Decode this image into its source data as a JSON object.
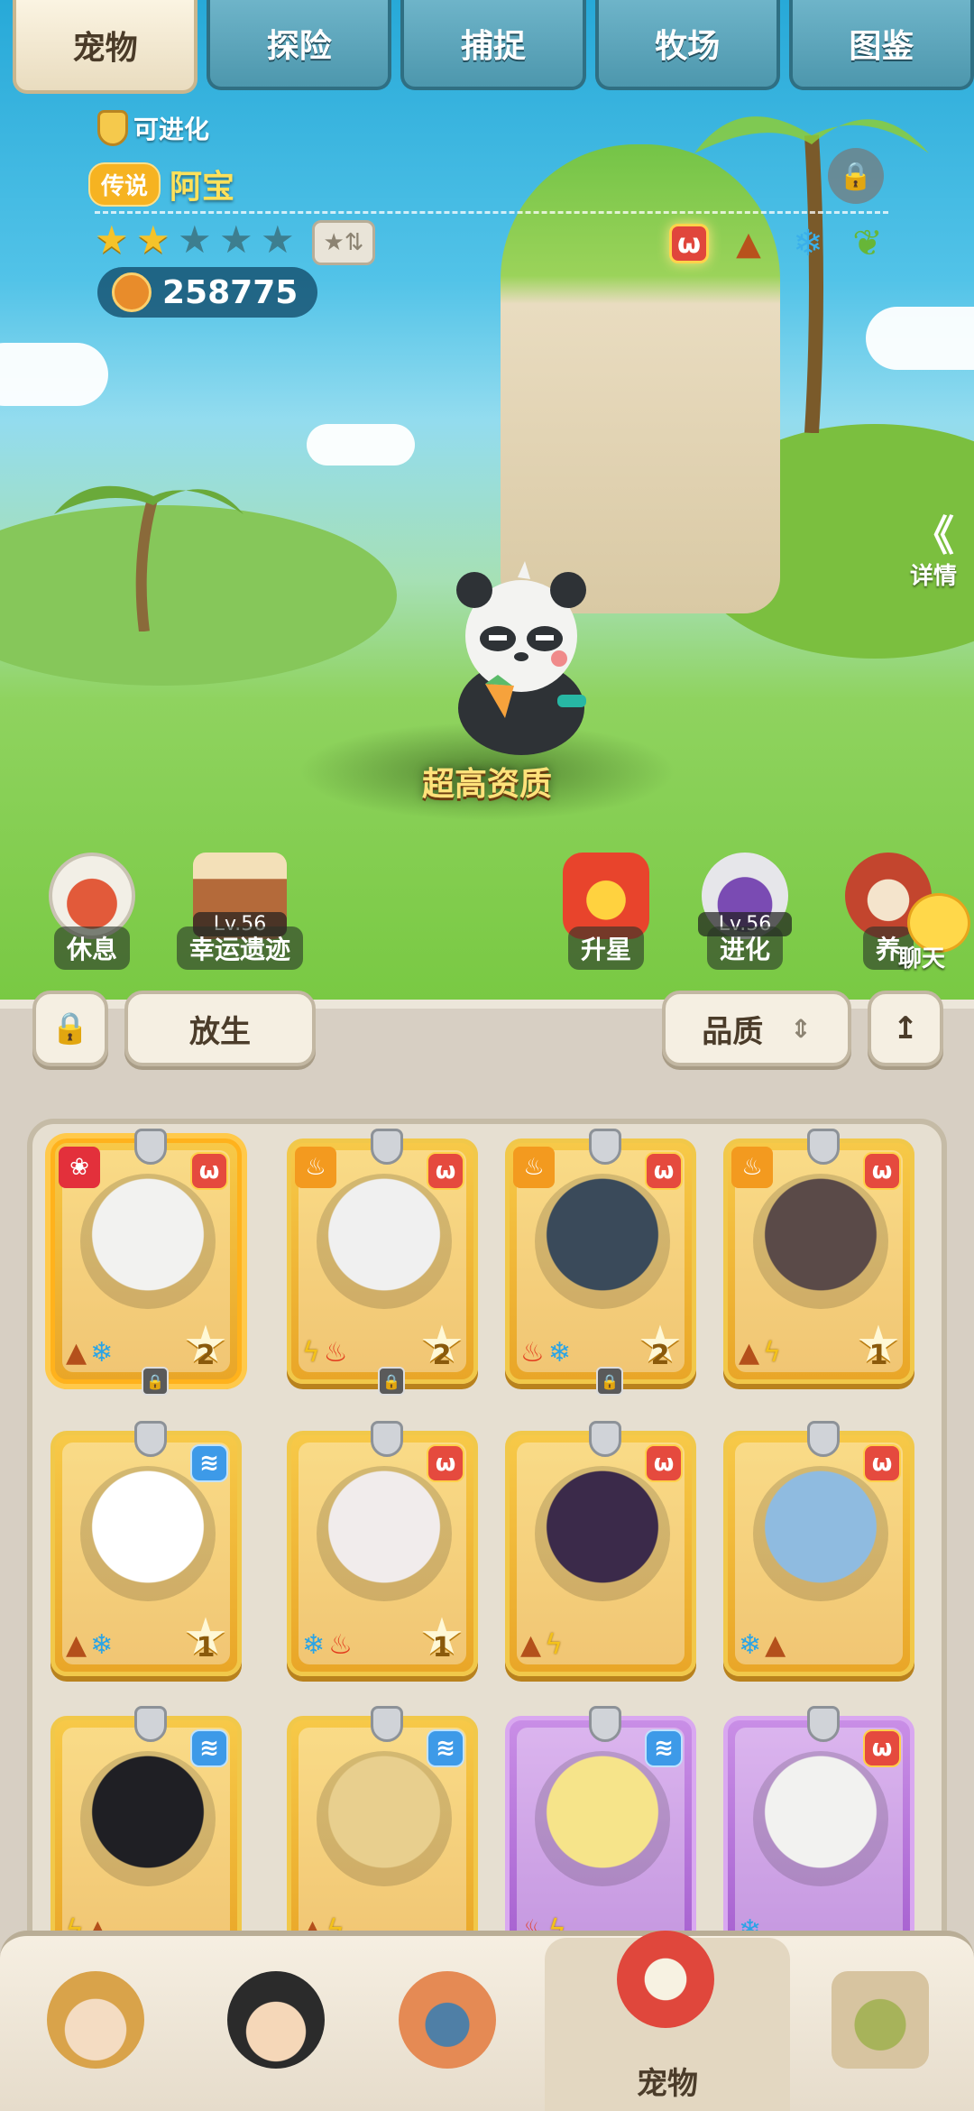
{
  "tabs": [
    "宠物",
    "探险",
    "捕捉",
    "牧场",
    "图鉴"
  ],
  "active_tab": "宠物",
  "pet": {
    "evolve_label": "可进化",
    "rarity": "传说",
    "name": "阿宝",
    "stars_filled": 2,
    "stars_total": 5,
    "power": "258775",
    "quality_text": "超高资质",
    "trait_icons": [
      "red-paw-trait-icon",
      "earth-trait-icon",
      "ice-trait-icon",
      "leaf-trait-icon"
    ]
  },
  "detail": {
    "chevron": "《",
    "label": "详情"
  },
  "actions": [
    {
      "label": "休息",
      "level": ""
    },
    {
      "label": "幸运遗迹",
      "level": "Lv.56"
    },
    {
      "label": "升星",
      "level": ""
    },
    {
      "label": "进化",
      "level": "Lv.56"
    },
    {
      "label": "养",
      "level": ""
    }
  ],
  "chat_label": "聊天",
  "controls": {
    "release": "放生",
    "quality": "品质",
    "quality_arrows": "⇕",
    "sort_icon": "↥",
    "lock_icon": "🔒"
  },
  "cards": [
    {
      "frame": "gold",
      "element": "red",
      "tag": "paw",
      "level": "2",
      "attrs": [
        "earth",
        "ice"
      ],
      "locked": true,
      "selected": true
    },
    {
      "frame": "gold",
      "element": "red",
      "tag": "hat",
      "level": "2",
      "attrs": [
        "bolt",
        "fire"
      ],
      "locked": true,
      "selected": false
    },
    {
      "frame": "gold",
      "element": "red",
      "tag": "hat",
      "level": "2",
      "attrs": [
        "fire",
        "ice"
      ],
      "locked": true,
      "selected": false
    },
    {
      "frame": "gold",
      "element": "red",
      "tag": "hat",
      "level": "1",
      "attrs": [
        "earth",
        "bolt"
      ],
      "locked": false,
      "selected": false
    },
    {
      "frame": "gold",
      "element": "blue",
      "tag": "",
      "level": "1",
      "attrs": [
        "earth",
        "ice"
      ],
      "locked": false,
      "selected": false
    },
    {
      "frame": "gold",
      "element": "red",
      "tag": "",
      "level": "1",
      "attrs": [
        "ice",
        "fire"
      ],
      "locked": false,
      "selected": false
    },
    {
      "frame": "gold",
      "element": "red",
      "tag": "",
      "level": "",
      "attrs": [
        "earth",
        "bolt"
      ],
      "locked": false,
      "selected": false
    },
    {
      "frame": "gold",
      "element": "red",
      "tag": "",
      "level": "",
      "attrs": [
        "ice",
        "earth"
      ],
      "locked": false,
      "selected": false
    },
    {
      "frame": "gold",
      "element": "blue",
      "tag": "",
      "level": "",
      "attrs": [
        "bolt",
        "earth"
      ],
      "locked": false,
      "selected": false
    },
    {
      "frame": "gold",
      "element": "blue",
      "tag": "",
      "level": "",
      "attrs": [
        "earth",
        "bolt"
      ],
      "locked": false,
      "selected": false
    },
    {
      "frame": "purple",
      "element": "blue",
      "tag": "",
      "level": "",
      "attrs": [
        "fire",
        "bolt"
      ],
      "locked": false,
      "selected": false
    },
    {
      "frame": "purple",
      "element": "red",
      "tag": "",
      "level": "",
      "attrs": [
        "ice"
      ],
      "locked": false,
      "selected": false
    }
  ],
  "bottom_nav": {
    "active_label": "宠物"
  },
  "colors": {
    "gold_card": "#f7c948",
    "purple_card": "#c98ee6",
    "accent_red": "#e54a3e",
    "tab_blue": "#5ea7bd"
  }
}
